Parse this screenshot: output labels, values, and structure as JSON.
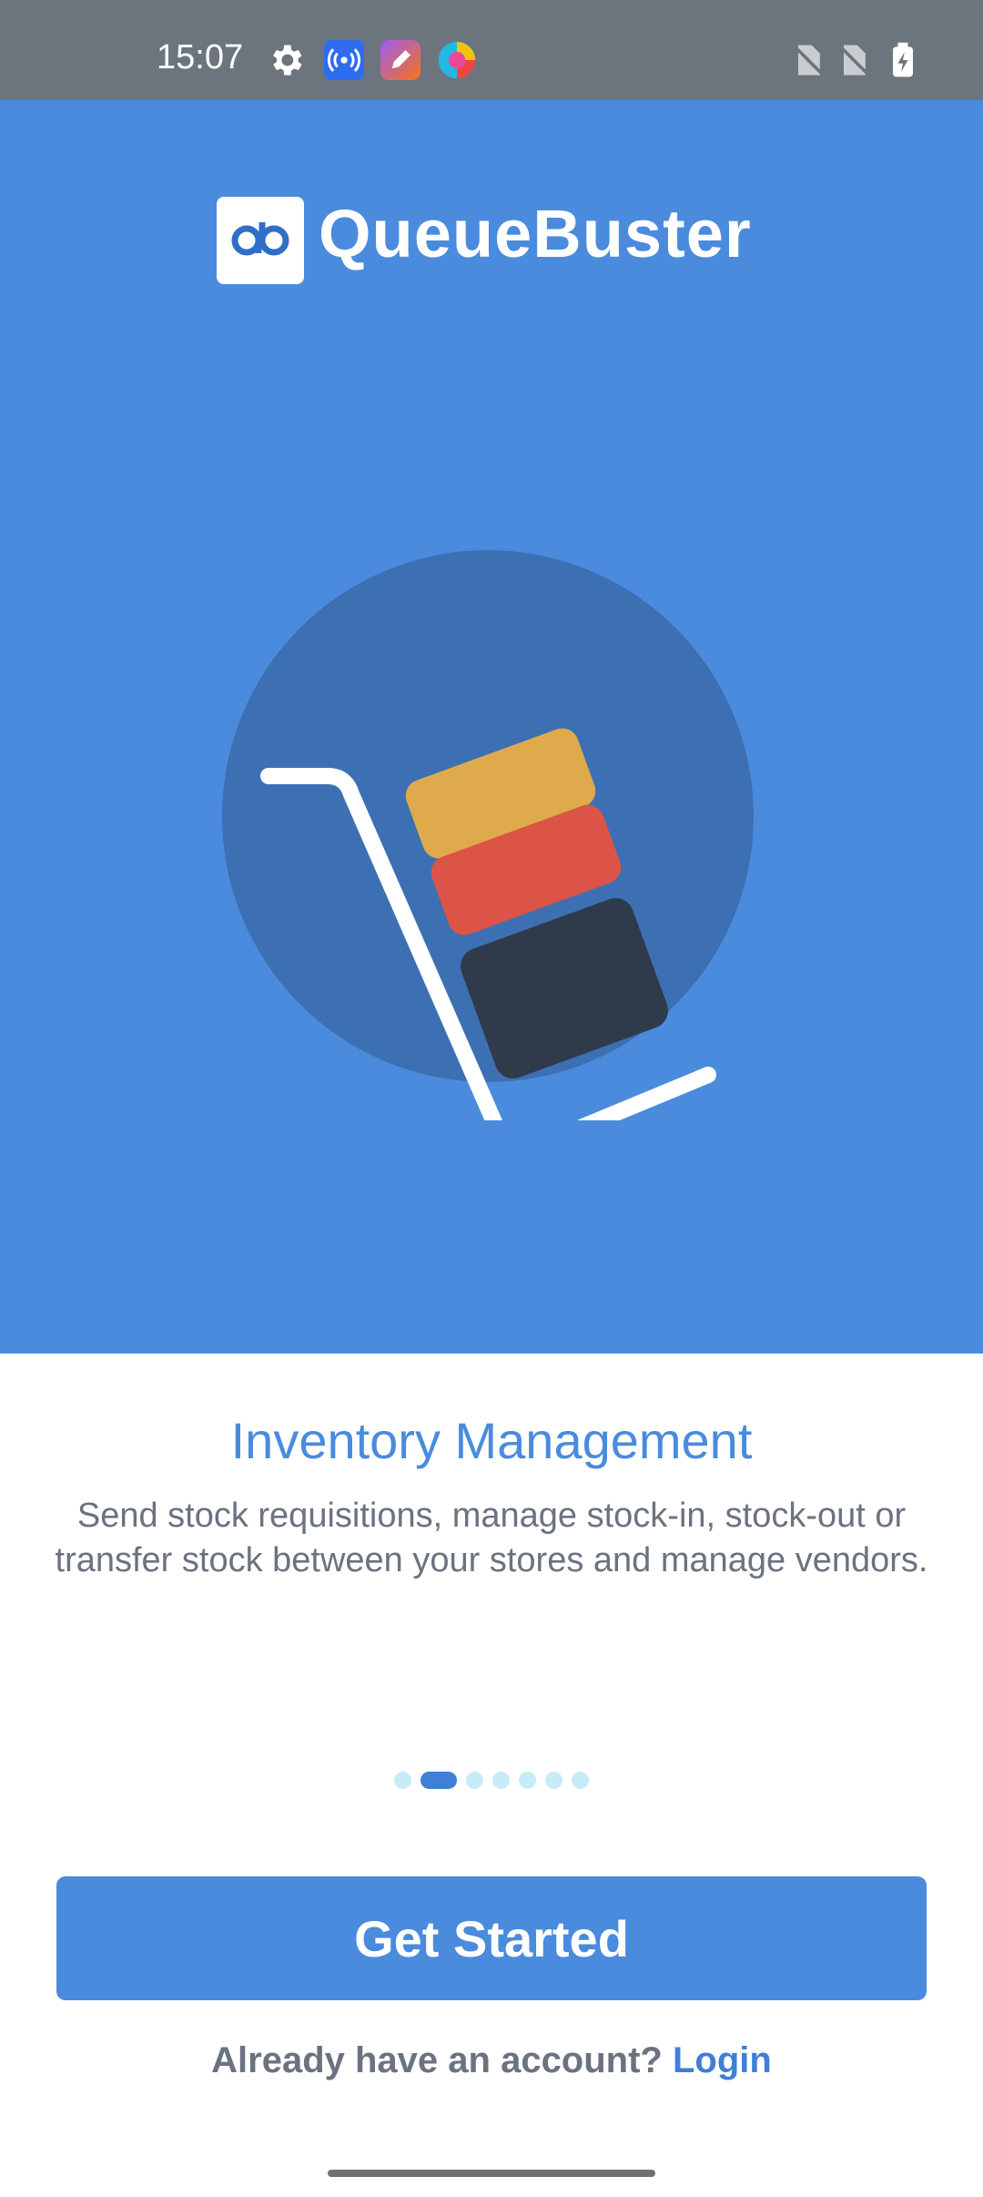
{
  "status_bar": {
    "time": "15:07",
    "icons": [
      "settings-gear-icon",
      "broadcast-icon",
      "pen-app-icon",
      "colorful-browser-icon",
      "no-sim-icon",
      "no-sim-icon",
      "battery-charging-icon"
    ]
  },
  "brand": {
    "logo_glyph": "qb",
    "name": "QueueBuster"
  },
  "slide": {
    "title": "Inventory Management",
    "description": "Send stock requisitions, manage stock-in, stock-out or transfer stock between your stores and manage vendors."
  },
  "pager": {
    "count": 7,
    "active_index": 1
  },
  "actions": {
    "get_started_label": "Get Started",
    "already_account_text": "Already have an account?",
    "login_label": "Login"
  },
  "colors": {
    "brand_blue": "#4a8bdd",
    "status_bar": "#6c757e",
    "box_yellow": "#deaa4b",
    "box_red": "#dc5347",
    "box_dark": "#2f3b4a"
  }
}
